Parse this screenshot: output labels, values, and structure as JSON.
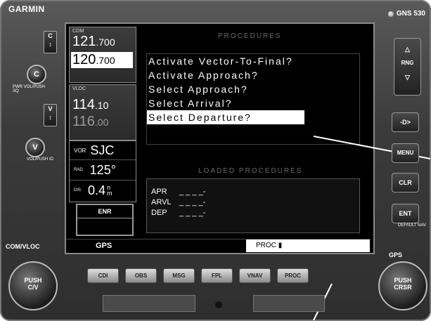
{
  "device": {
    "brand": "GARMIN",
    "model": "GNS 530"
  },
  "left_panel": {
    "com_label": "COM",
    "com_active": {
      "main": "121",
      "frac": ".700"
    },
    "com_standby": {
      "main": "120",
      "frac": ".700"
    },
    "vloc_label": "VLOC",
    "vloc_active": {
      "main": "114",
      "frac": ".10"
    },
    "vloc_standby": {
      "main": "116",
      "frac": ".00"
    },
    "vor_label": "VOR",
    "vor_value": "SJC",
    "rad_label": "RAD",
    "rad_value": "125°",
    "dis_label": "DIS",
    "dis_value": "0.4",
    "dis_unit_top": "n",
    "dis_unit_bottom": "m",
    "cdi_mode": "ENR"
  },
  "procedures": {
    "title": "PROCEDURES",
    "items": [
      "Activate Vector-To-Final?",
      "Activate Approach?",
      "Select Approach?",
      "Select Arrival?",
      "Select Departure?"
    ],
    "selected_index": 4
  },
  "loaded": {
    "title": "LOADED PROCEDURES",
    "rows": [
      {
        "label": "APR",
        "value": "_ _ _ _-"
      },
      {
        "label": "ARVL",
        "value": "_ _ _ _-"
      },
      {
        "label": "DEP",
        "value": "_ _ _ _-"
      }
    ]
  },
  "status_bar": {
    "mode": "GPS",
    "page": "PROC"
  },
  "bottom_buttons": [
    "CDI",
    "OBS",
    "MSG",
    "FPL",
    "VNAV",
    "PROC"
  ],
  "left_controls": {
    "c_toggle": "C",
    "v_toggle": "V",
    "c_knob": "C",
    "v_knob": "V",
    "pwr_label": "PWR VOL/PUSH SQ",
    "vol_id_label": "VOL/PUSH ID",
    "com_vloc_label": "COM/VLOC",
    "push_civ": "PUSH C/V"
  },
  "right_controls": {
    "rng": "RNG",
    "direct_to": "-D>",
    "menu": "MENU",
    "clr": "CLR",
    "ent": "ENT",
    "default_nav": "DEFAULT NAV",
    "gps_label": "GPS",
    "push_crsr": "PUSH CRSR"
  }
}
